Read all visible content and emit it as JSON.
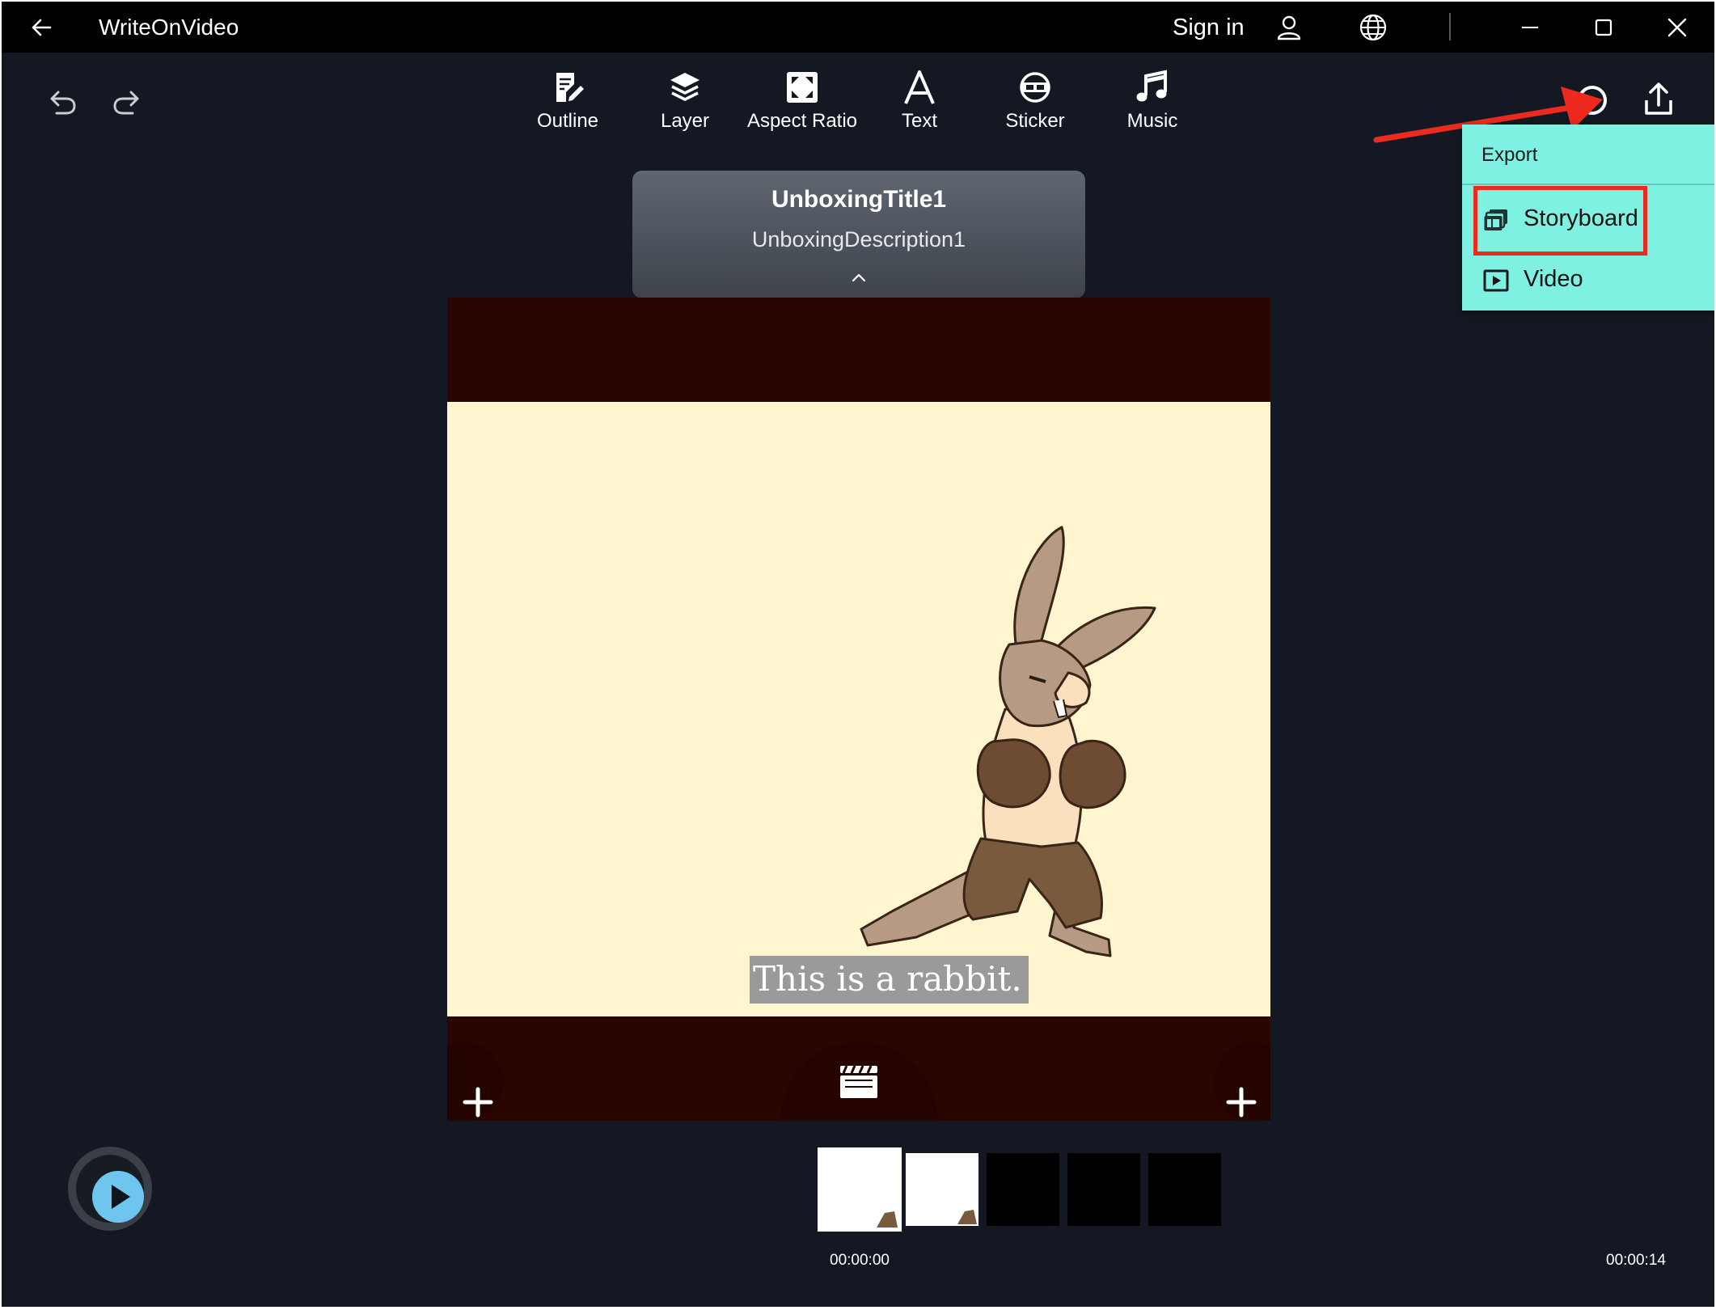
{
  "app": {
    "title": "WriteOnVideo",
    "signin_label": "Sign in"
  },
  "toolbar": {
    "items": [
      {
        "label": "Outline"
      },
      {
        "label": "Layer"
      },
      {
        "label": "Aspect Ratio"
      },
      {
        "label": "Text"
      },
      {
        "label": "Sticker"
      },
      {
        "label": "Music"
      }
    ]
  },
  "export_menu": {
    "header": "Export",
    "items": [
      {
        "label": "Storyboard"
      },
      {
        "label": "Video"
      }
    ]
  },
  "scene": {
    "title": "UnboxingTitle1",
    "description": "UnboxingDescription1",
    "caption": "This is a rabbit."
  },
  "timeline": {
    "start_time": "00:00:00",
    "end_time": "00:00:14"
  },
  "colors": {
    "background": "#131822",
    "titlebar": "#000000",
    "menu": "#7ef1e3",
    "highlight": "#ee2a1e",
    "stage": "#2b0600",
    "frame": "#fff5cf",
    "play_button": "#6ec6ef"
  }
}
